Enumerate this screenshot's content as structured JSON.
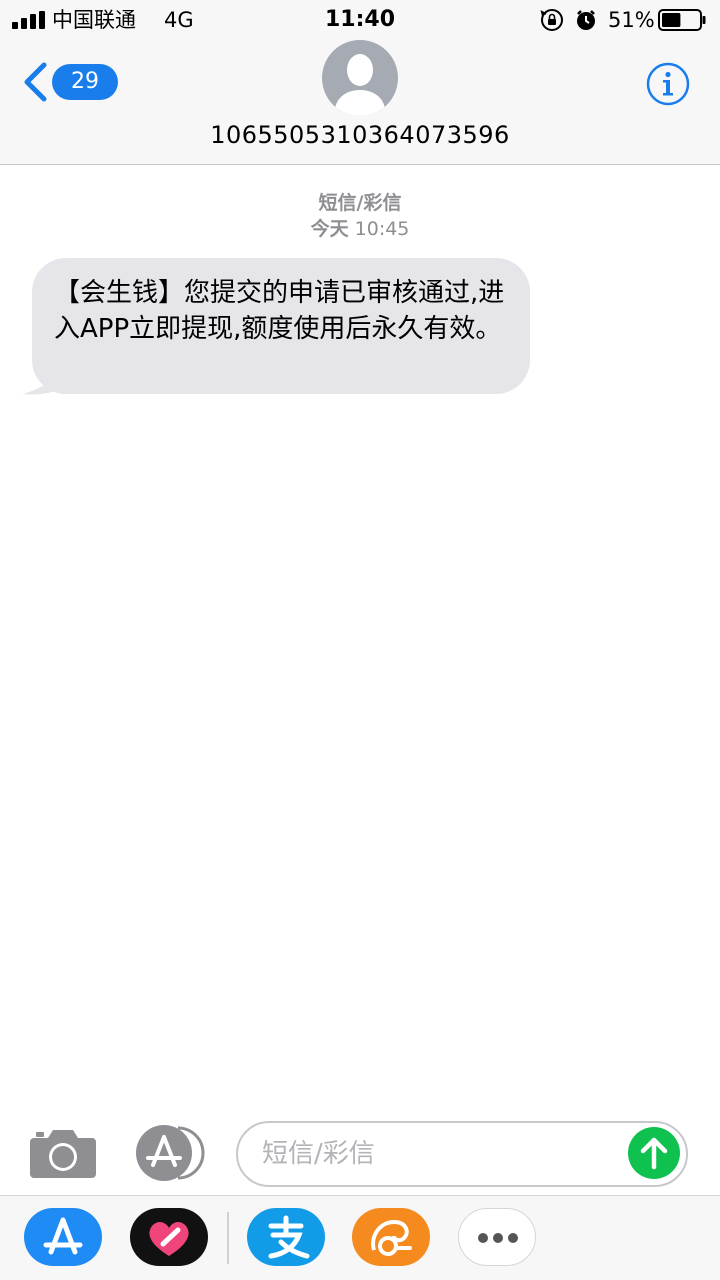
{
  "status_bar": {
    "carrier": "中国联通",
    "network": "4G",
    "time": "11:40",
    "battery_percent": "51%",
    "battery_level": 0.51
  },
  "header": {
    "back_count": "29",
    "contact_number": "1065505310364073596",
    "icons": {
      "back": "chevron-left-icon",
      "avatar": "person-silhouette-icon",
      "info": "info-icon"
    }
  },
  "thread": {
    "message_type": "短信/彩信",
    "timestamp_day": "今天",
    "timestamp_time": "10:45",
    "messages": [
      {
        "direction": "incoming",
        "text": "【会生钱】您提交的申请已审核通过,进入APP立即提现,额度使用后永久有效。"
      }
    ]
  },
  "compose": {
    "placeholder": "短信/彩信",
    "icons": {
      "camera": "camera-icon",
      "apps": "app-store-icon",
      "send": "arrow-up-icon"
    }
  },
  "app_drawer": {
    "apps": [
      {
        "name": "app-store-icon",
        "color": "#1f8cf5"
      },
      {
        "name": "heart-app-icon",
        "color": "#111111"
      },
      {
        "name": "alipay-icon",
        "color": "#129ce8"
      },
      {
        "name": "uc-browser-icon",
        "color": "#f58a1f"
      },
      {
        "name": "more-icon",
        "color": "#ffffff"
      }
    ]
  },
  "colors": {
    "accent": "#1a7dec",
    "bubble_incoming": "#e5e5ea",
    "send": "#0fc14e",
    "meta_text": "#8e8e93"
  }
}
